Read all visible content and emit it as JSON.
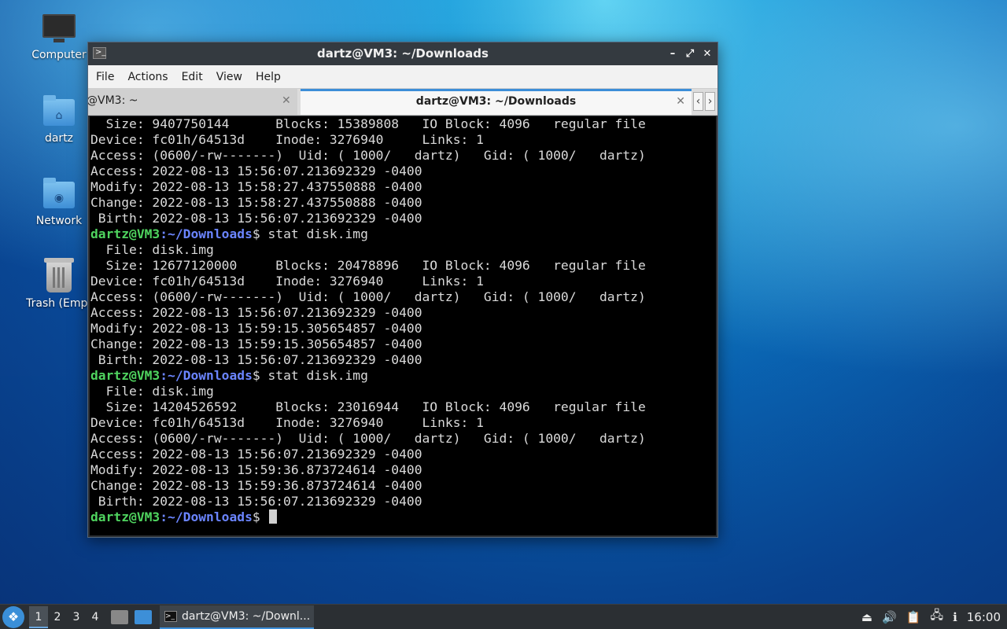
{
  "desktop": {
    "icons": [
      {
        "label": "Computer",
        "icon": "monitor-icon"
      },
      {
        "label": "dartz",
        "icon": "home-folder-icon"
      },
      {
        "label": "Network",
        "icon": "network-folder-icon"
      },
      {
        "label": "Trash (Empt",
        "icon": "trash-icon"
      }
    ]
  },
  "window": {
    "title": "dartz@VM3: ~/Downloads",
    "controls": {
      "minimize": "–",
      "maximize": "⤢",
      "close": "✕"
    },
    "menu": [
      "File",
      "Actions",
      "Edit",
      "View",
      "Help"
    ],
    "tabs": [
      {
        "label": "@VM3: ~",
        "close": "✕",
        "active": false
      },
      {
        "label": "dartz@VM3: ~/Downloads",
        "close": "✕",
        "active": true
      }
    ],
    "tab_nav": {
      "prev": "‹",
      "next": "›"
    }
  },
  "terminal": {
    "prompt_user": "dartz@VM3",
    "prompt_sep": ":",
    "prompt_path": "~/Downloads",
    "prompt_end": "$ ",
    "lines": [
      {
        "type": "out",
        "text": "  Size: 9407750144      Blocks: 15389808   IO Block: 4096   regular file"
      },
      {
        "type": "out",
        "text": "Device: fc01h/64513d    Inode: 3276940     Links: 1"
      },
      {
        "type": "out",
        "text": "Access: (0600/-rw-------)  Uid: ( 1000/   dartz)   Gid: ( 1000/   dartz)"
      },
      {
        "type": "out",
        "text": "Access: 2022-08-13 15:56:07.213692329 -0400"
      },
      {
        "type": "out",
        "text": "Modify: 2022-08-13 15:58:27.437550888 -0400"
      },
      {
        "type": "out",
        "text": "Change: 2022-08-13 15:58:27.437550888 -0400"
      },
      {
        "type": "out",
        "text": " Birth: 2022-08-13 15:56:07.213692329 -0400"
      },
      {
        "type": "cmd",
        "text": "stat disk.img"
      },
      {
        "type": "out",
        "text": "  File: disk.img"
      },
      {
        "type": "out",
        "text": "  Size: 12677120000     Blocks: 20478896   IO Block: 4096   regular file"
      },
      {
        "type": "out",
        "text": "Device: fc01h/64513d    Inode: 3276940     Links: 1"
      },
      {
        "type": "out",
        "text": "Access: (0600/-rw-------)  Uid: ( 1000/   dartz)   Gid: ( 1000/   dartz)"
      },
      {
        "type": "out",
        "text": "Access: 2022-08-13 15:56:07.213692329 -0400"
      },
      {
        "type": "out",
        "text": "Modify: 2022-08-13 15:59:15.305654857 -0400"
      },
      {
        "type": "out",
        "text": "Change: 2022-08-13 15:59:15.305654857 -0400"
      },
      {
        "type": "out",
        "text": " Birth: 2022-08-13 15:56:07.213692329 -0400"
      },
      {
        "type": "cmd",
        "text": "stat disk.img"
      },
      {
        "type": "out",
        "text": "  File: disk.img"
      },
      {
        "type": "out",
        "text": "  Size: 14204526592     Blocks: 23016944   IO Block: 4096   regular file"
      },
      {
        "type": "out",
        "text": "Device: fc01h/64513d    Inode: 3276940     Links: 1"
      },
      {
        "type": "out",
        "text": "Access: (0600/-rw-------)  Uid: ( 1000/   dartz)   Gid: ( 1000/   dartz)"
      },
      {
        "type": "out",
        "text": "Access: 2022-08-13 15:56:07.213692329 -0400"
      },
      {
        "type": "out",
        "text": "Modify: 2022-08-13 15:59:36.873724614 -0400"
      },
      {
        "type": "out",
        "text": "Change: 2022-08-13 15:59:36.873724614 -0400"
      },
      {
        "type": "out",
        "text": " Birth: 2022-08-13 15:56:07.213692329 -0400"
      },
      {
        "type": "prompt",
        "text": ""
      }
    ]
  },
  "taskbar": {
    "start_icon": "app-menu-icon",
    "workspaces": [
      "1",
      "2",
      "3",
      "4"
    ],
    "active_workspace": "1",
    "task_label": "dartz@VM3: ~/Downl...",
    "clock": "16:00",
    "tray_icons": [
      "eject-icon",
      "volume-icon",
      "clipboard-icon",
      "network-icon",
      "update-icon"
    ]
  },
  "colors": {
    "prompt_user": "#4fd45f",
    "prompt_path": "#6b85ff",
    "accent": "#3c8ed8",
    "terminal_bg": "#000000"
  }
}
